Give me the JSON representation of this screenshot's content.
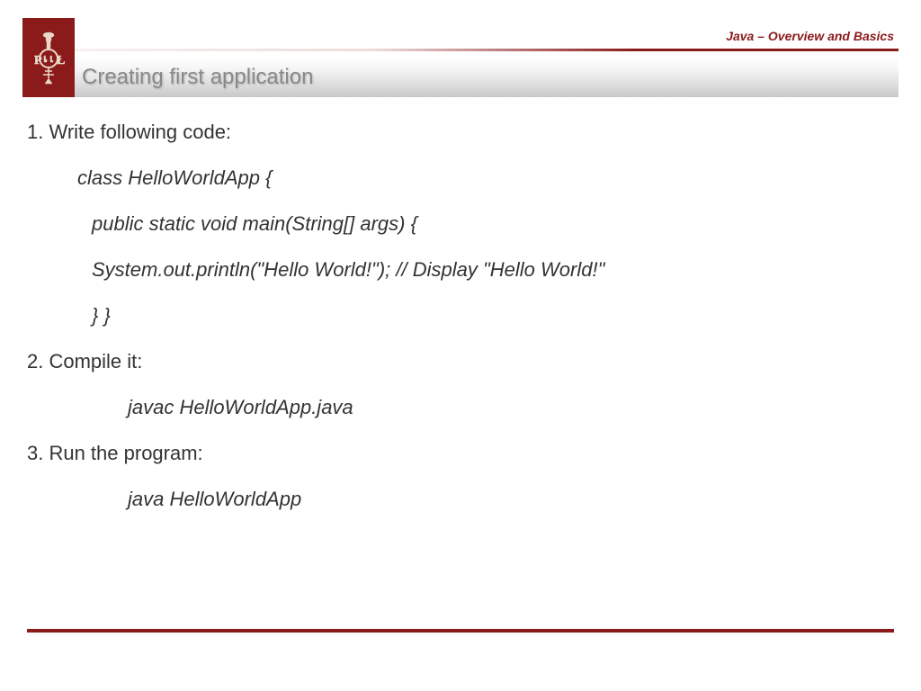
{
  "header": {
    "course_label": "Java – Overview and Basics",
    "slide_title": "Creating first application"
  },
  "content": {
    "step1_label": "1. Write following code:",
    "code_line1": "class HelloWorldApp {",
    "code_line2": "public static void main(String[] args) {",
    "code_line3": "System.out.println(\"Hello World!\"); // Display \"Hello World!\"",
    "code_line4": "} }",
    "step2_label": "2. Compile it:",
    "step2_cmd": "javac HelloWorldApp.java",
    "step3_label": "3. Run the program:",
    "step3_cmd": "java HelloWorldApp"
  }
}
